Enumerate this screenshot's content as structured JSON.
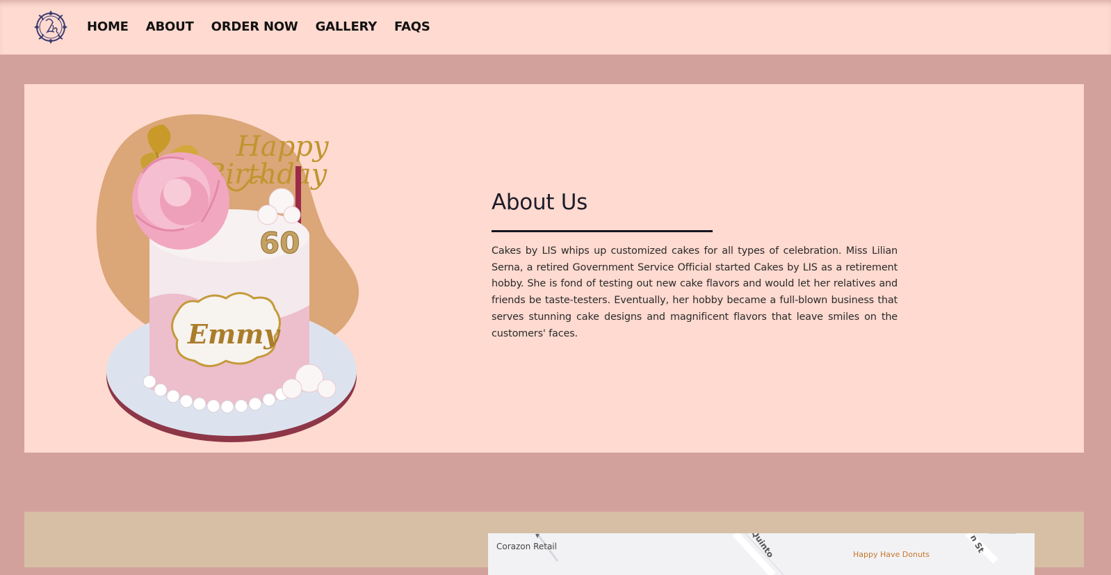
{
  "nav": {
    "items": [
      "HOME",
      "ABOUT",
      "ORDER NOW",
      "GALLERY",
      "FAQS"
    ]
  },
  "about": {
    "title": "About Us",
    "body": "Cakes by LIS whips up customized cakes for all types of celebration. Miss Lilian Serna, a retired Government Service Official started Cakes by LIS as a retirement hobby. She is fond of testing out new cake flavors and would let her relatives and friends be taste-testers. Eventually, her hobby became a full-blown business that serves stunning cake designs and magnificent flavors that leave smiles on the customers' faces.",
    "cake_topper_top": "Happy",
    "cake_topper_bottom": "Birthday",
    "cake_age": "60",
    "cake_name": "Emmy"
  },
  "map": {
    "label_corazon": "Corazon Retail",
    "label_donuts": "Happy Have Donuts",
    "label_street1": "Quinto",
    "label_street2": "n St"
  },
  "colors": {
    "page_bg": "#d3a19b",
    "panel_bg": "#fedad0",
    "contact_bg": "#d7bfa6",
    "text_dark": "#1c1c2a"
  }
}
